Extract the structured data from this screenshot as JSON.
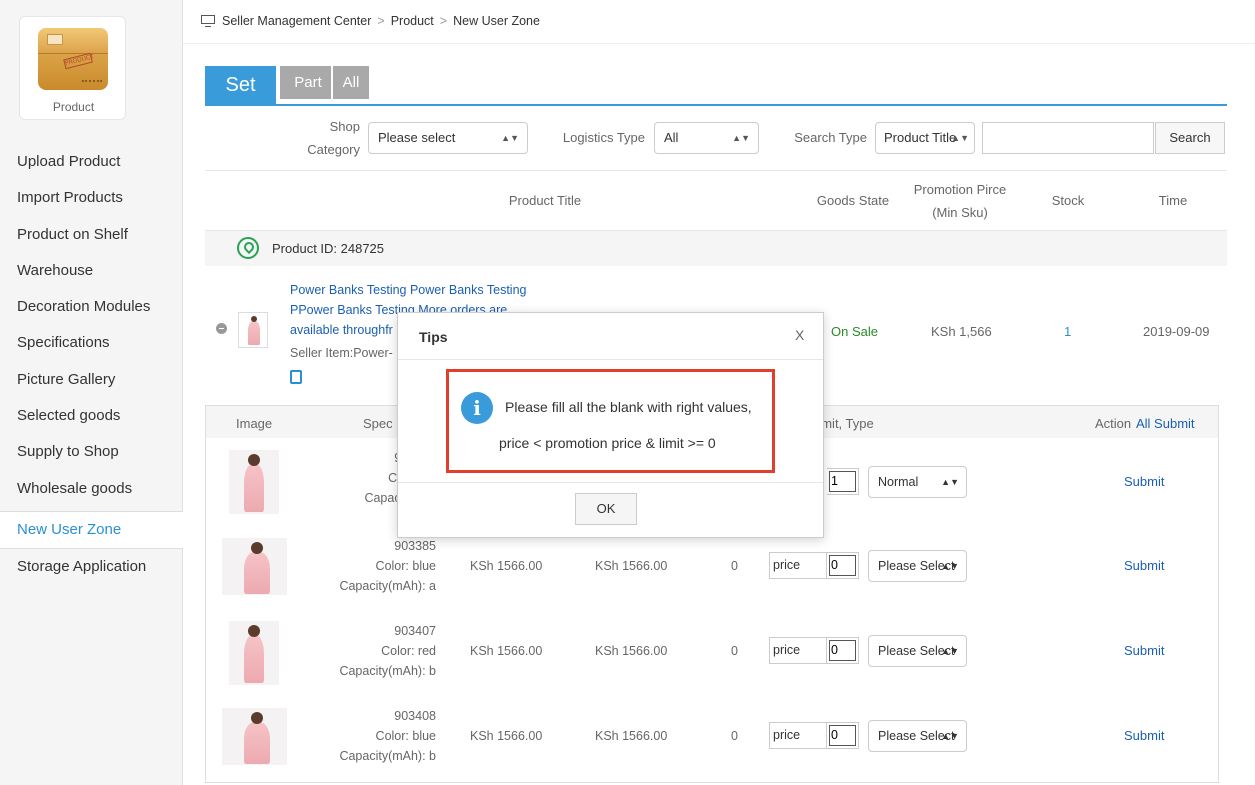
{
  "app": {
    "name": "Product"
  },
  "sidebar": {
    "items": [
      {
        "label": "Upload Product"
      },
      {
        "label": "Import Products"
      },
      {
        "label": "Product on Shelf"
      },
      {
        "label": "Warehouse"
      },
      {
        "label": "Decoration Modules"
      },
      {
        "label": "Specifications"
      },
      {
        "label": "Picture Gallery"
      },
      {
        "label": "Selected goods"
      },
      {
        "label": "Supply to Shop"
      },
      {
        "label": "Wholesale goods"
      },
      {
        "label": "New User Zone",
        "active": true
      },
      {
        "label": "Storage Application"
      }
    ]
  },
  "breadcrumb": {
    "items": [
      "Seller Management Center",
      "Product",
      "New User Zone"
    ],
    "separator": ">"
  },
  "tabs": {
    "set": "Set",
    "part": "Part",
    "all": "All"
  },
  "filters": {
    "shop_category_label_1": "Shop",
    "shop_category_label_2": "Category",
    "shop_category_value": "Please select",
    "logistics_label": "Logistics Type",
    "logistics_value": "All",
    "search_type_label": "Search Type",
    "search_type_value": "Product Title",
    "search_value": "",
    "search_button": "Search"
  },
  "table": {
    "headers": {
      "title": "Product Title",
      "goods_state": "Goods State",
      "promo_1": "Promotion Pirce",
      "promo_2": "(Min Sku)",
      "stock": "Stock",
      "time": "Time"
    },
    "product": {
      "id_label": "Product ID: 248725",
      "title_line1": "Power Banks Testing Power Banks Testing",
      "title_line2": "PPower Banks Testing More orders are",
      "title_line3": "available throughfr",
      "seller_item": "Seller Item:Power-",
      "state": "On Sale",
      "price": "KSh 1,566",
      "stock": "1",
      "time": "2019-09-09"
    }
  },
  "sku": {
    "headers": {
      "image": "Image",
      "spec": "Spec",
      "limit_type": "y Limit, Type",
      "action": "Action",
      "all_submit": "All Submit"
    },
    "rows": [
      {
        "id": "903384",
        "color": "Color: re",
        "capacity": "Capacity(mA",
        "price": "",
        "promo_price": "",
        "zero": "",
        "price_placeholder": "",
        "limit": "1",
        "type": "Normal",
        "submit": "Submit"
      },
      {
        "id": "903385",
        "color": "Color: blue",
        "capacity": "Capacity(mAh): a",
        "price": "KSh 1566.00",
        "promo_price": "KSh 1566.00",
        "zero": "0",
        "price_placeholder": "price",
        "limit": "0",
        "type": "Please Select",
        "submit": "Submit"
      },
      {
        "id": "903407",
        "color": "Color: red",
        "capacity": "Capacity(mAh): b",
        "price": "KSh 1566.00",
        "promo_price": "KSh 1566.00",
        "zero": "0",
        "price_placeholder": "price",
        "limit": "0",
        "type": "Please Select",
        "submit": "Submit"
      },
      {
        "id": "903408",
        "color": "Color: blue",
        "capacity": "Capacity(mAh): b",
        "price": "KSh 1566.00",
        "promo_price": "KSh 1566.00",
        "zero": "0",
        "price_placeholder": "price",
        "limit": "0",
        "type": "Please Select",
        "submit": "Submit"
      }
    ]
  },
  "modal": {
    "title": "Tips",
    "close": "X",
    "message_line1": "Please fill all the blank with right values,",
    "message_line2": "price < promotion price & limit >= 0",
    "info_glyph": "i",
    "ok": "OK"
  },
  "colors": {
    "accent": "#3a9bdb",
    "link": "#1a5fb4",
    "success": "#2a8a2a",
    "highlight": "#e0402b"
  }
}
